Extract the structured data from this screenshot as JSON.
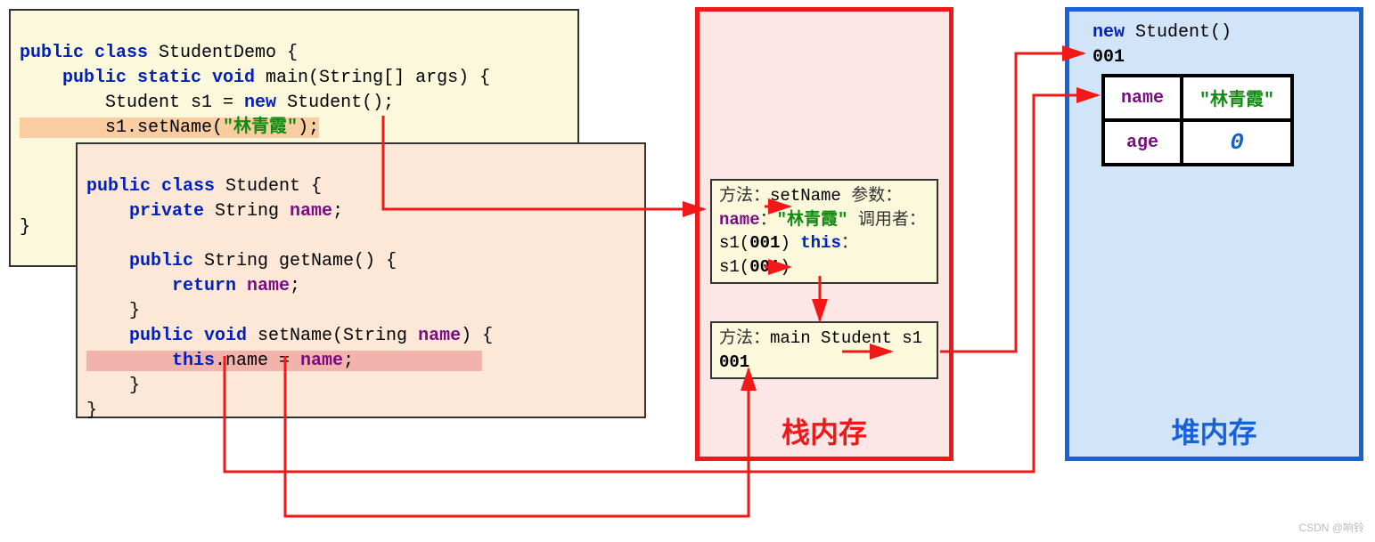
{
  "code1": {
    "l1_1": "public class",
    "l1_2": " StudentDemo {",
    "l2_1": "    public static void",
    "l2_2": " main(String[] args) {",
    "l3_1": "        Student s1 = ",
    "l3_2": "new",
    "l3_3": " Student();",
    "l4_1": "        s1.setName(",
    "l4_2": "\"林青霞\"",
    "l4_3": ");",
    "l5": "}"
  },
  "code2": {
    "l1_1": "public class",
    "l1_2": " Student {",
    "l2_1": "    private",
    "l2_2": " String ",
    "l2_3": "name",
    "l2_4": ";",
    "blank": "",
    "l3_1": "    public",
    "l3_2": " String getName() {",
    "l4_1": "        return",
    "l4_2": " name",
    "l4_3": ";",
    "l5": "    }",
    "l6_1": "    public void",
    "l6_2": " setName(String ",
    "l6_3": "name",
    "l6_4": ") {",
    "l7_1": "        ",
    "l7_2": "this",
    "l7_3": ".name = ",
    "l7_4": "name",
    "l7_5": ";",
    "l8": "    }",
    "l9": "}"
  },
  "stack": {
    "title": "栈内存",
    "frame1": {
      "l1a": "方法：",
      "l1b": "setName",
      "l2a": "参数：",
      "l2b": "name",
      "l2c": "：",
      "l2d": "\"林青霞\"",
      "l3a": "调用者：",
      "l3b": "s1(",
      "l3c": "001",
      "l3d": ")",
      "l4a": "this",
      "l4b": "：",
      "l4c": "s1(",
      "l4d": "001",
      "l4e": ")"
    },
    "frame2": {
      "l1a": "方法：",
      "l1b": "main",
      "l2a": " Student s1",
      "l2b": "001"
    }
  },
  "heap": {
    "title": "堆内存",
    "new_kw": "new",
    "new_obj": " Student()",
    "addr": "001",
    "name_key": "name",
    "name_val": "\"林青霞\"",
    "age_key": "age",
    "age_val": "0"
  },
  "watermark": "CSDN @响铃"
}
